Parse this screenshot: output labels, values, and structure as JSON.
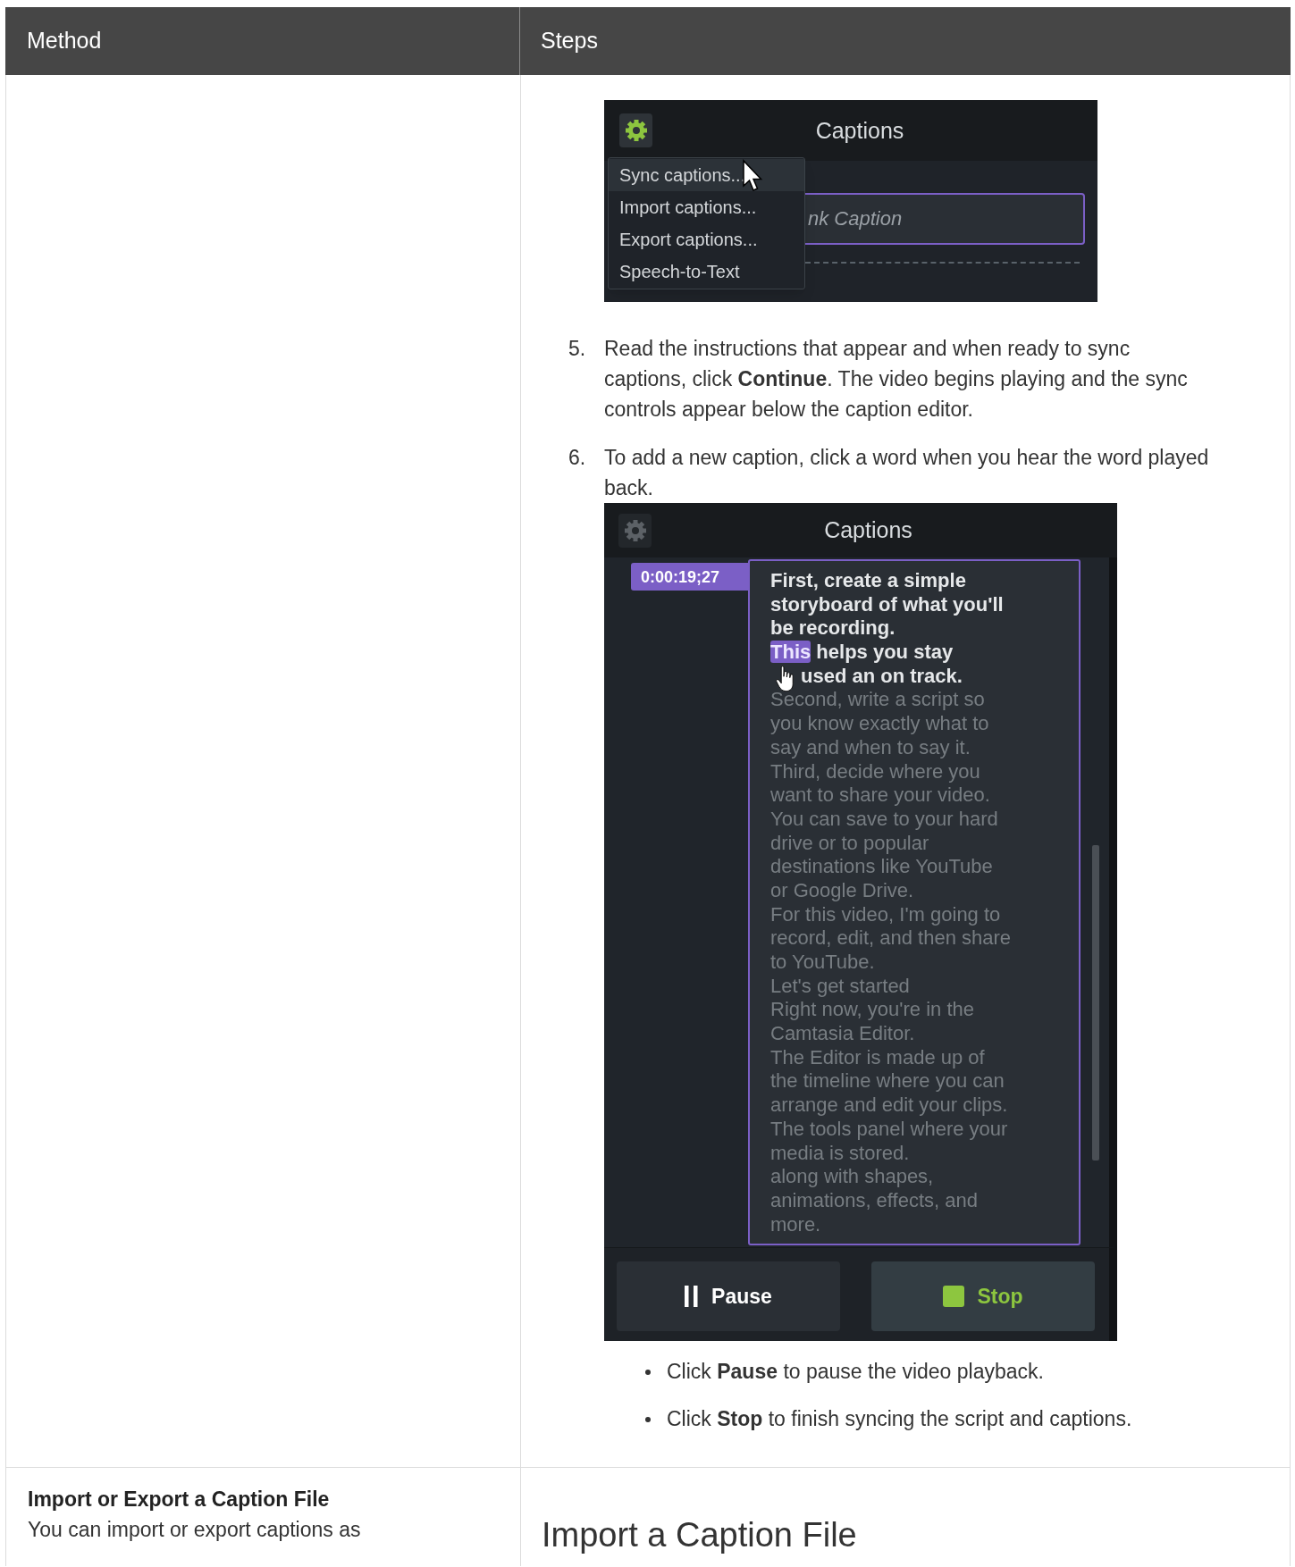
{
  "columns": [
    "Method",
    "Steps"
  ],
  "sync_row": {
    "menu_screenshot": {
      "title": "Captions",
      "settings_active": true,
      "placeholder": "nk Caption",
      "menu": [
        {
          "label": "Sync captions...",
          "selected": true
        },
        {
          "label": "Import captions...",
          "selected": false
        },
        {
          "label": "Export captions...",
          "selected": false
        },
        {
          "label": "Speech-to-Text",
          "selected": false
        }
      ]
    },
    "steps": [
      {
        "number": "5.",
        "text": "Read the instructions that appear and when ready to sync captions, click **Continue**. The video begins playing and the sync controls appear below the caption editor."
      },
      {
        "number": "6.",
        "text": "To add a new caption, click a word when you hear the word played back."
      }
    ],
    "sync_screenshot": {
      "title": "Captions",
      "settings_active": false,
      "timestamp": "0:00:19;27",
      "lines": [
        {
          "kind": "spoken",
          "covered": false,
          "text": "First, create a simple"
        },
        {
          "kind": "spoken",
          "covered": false,
          "text": "storyboard of what you'll"
        },
        {
          "kind": "spoken",
          "covered": false,
          "text": "be recording."
        },
        {
          "kind": "spoken",
          "covered": false,
          "segments": [
            {
              "text": "This",
              "selected": true
            },
            {
              "text": " helps you stay",
              "selected": false
            }
          ]
        },
        {
          "kind": "spoken",
          "covered": true,
          "text": "used an on track."
        },
        {
          "kind": "pending",
          "covered": false,
          "text": "Second, write a script so"
        },
        {
          "kind": "pending",
          "covered": false,
          "text": "you know exactly what to"
        },
        {
          "kind": "pending",
          "covered": false,
          "text": "say and when to say it."
        },
        {
          "kind": "pending",
          "covered": false,
          "text": "Third, decide where you"
        },
        {
          "kind": "pending",
          "covered": false,
          "text": "want to share your video."
        },
        {
          "kind": "pending",
          "covered": false,
          "text": "You can save to your hard"
        },
        {
          "kind": "pending",
          "covered": false,
          "text": "drive or to popular"
        },
        {
          "kind": "pending",
          "covered": false,
          "text": "destinations like YouTube"
        },
        {
          "kind": "pending",
          "covered": false,
          "text": "or Google Drive."
        },
        {
          "kind": "pending",
          "covered": false,
          "text": "For this video, I'm going to"
        },
        {
          "kind": "pending",
          "covered": false,
          "text": "record, edit, and then share"
        },
        {
          "kind": "pending",
          "covered": false,
          "text": "to YouTube."
        },
        {
          "kind": "pending",
          "covered": false,
          "text": "Let's get started"
        },
        {
          "kind": "pending",
          "covered": false,
          "text": "Right now, you're in the"
        },
        {
          "kind": "pending",
          "covered": false,
          "text": "Camtasia Editor."
        },
        {
          "kind": "pending",
          "covered": false,
          "text": "The Editor is made up of"
        },
        {
          "kind": "pending",
          "covered": false,
          "text": "the timeline where you can"
        },
        {
          "kind": "pending",
          "covered": false,
          "text": "arrange and edit your clips."
        },
        {
          "kind": "pending",
          "covered": false,
          "text": "The tools panel where your"
        },
        {
          "kind": "pending",
          "covered": false,
          "text": "media is stored."
        },
        {
          "kind": "pending",
          "covered": false,
          "text": "along with shapes,"
        },
        {
          "kind": "pending",
          "covered": false,
          "text": "animations, effects, and"
        },
        {
          "kind": "pending",
          "covered": false,
          "text": "more."
        }
      ],
      "buttons": [
        {
          "kind": "pause",
          "label": "Pause"
        },
        {
          "kind": "stop",
          "label": "Stop"
        }
      ]
    },
    "bullets": [
      "Click **Pause** to pause the video playback.",
      "Click **Stop** to finish syncing the script and captions."
    ]
  },
  "import_row": {
    "method_title": "Import or Export a Caption File",
    "method_text": "You can import or export captions as",
    "heading": "Import a Caption File"
  }
}
